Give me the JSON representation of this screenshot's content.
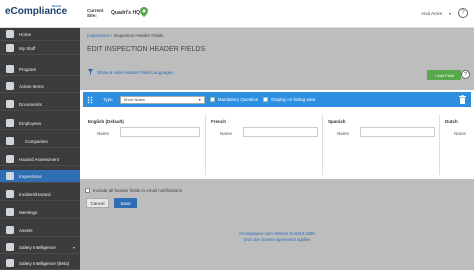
{
  "header": {
    "logo_text": "eCompliance",
    "logo_badge": "Mobile",
    "current_site_label": "Current\nSite:",
    "site_name": "Quadri's HQ",
    "user_name": "Anul Arora",
    "user_caret": "▾",
    "help": "?"
  },
  "sidebar": {
    "items": [
      {
        "label": "Home",
        "icon": "home-icon",
        "active": false
      },
      {
        "label": "My Stuff",
        "icon": "folder-icon",
        "active": false
      },
      {
        "label": "Program",
        "icon": "program-icon",
        "active": false
      },
      {
        "label": "Action Items",
        "icon": "checklist-icon",
        "active": false
      },
      {
        "label": "Documents",
        "icon": "document-icon",
        "active": false
      },
      {
        "label": "Employees",
        "icon": "employee-icon",
        "active": false
      },
      {
        "label": "Companies",
        "icon": "company-icon",
        "active": false
      },
      {
        "label": "Hazard Assessment",
        "icon": "hazard-icon",
        "active": false
      },
      {
        "label": "Inspections",
        "icon": "inspection-icon",
        "active": true
      },
      {
        "label": "Incident/Hazard",
        "icon": "incident-icon",
        "active": false
      },
      {
        "label": "Meetings",
        "icon": "meeting-icon",
        "active": false
      },
      {
        "label": "Assets",
        "icon": "asset-icon",
        "active": false
      },
      {
        "label": "Safety Intelligence",
        "icon": "chart-icon",
        "active": false
      },
      {
        "label": "Safety Intelligence (Beta)",
        "icon": "chart-icon",
        "active": false
      }
    ]
  },
  "breadcrumb": {
    "parent": "Inspections",
    "separator": "/",
    "current": "Inspection Header Fields"
  },
  "page_title": "EDIT INSPECTION HEADER FIELDS",
  "toolbar": {
    "language_link": "Show & Hide Header Field Languages",
    "add_field": "+ Add Field",
    "help": "?"
  },
  "field": {
    "type_label": "Type",
    "type_value": "Short Notes",
    "type_caret": "▾",
    "mandatory_label": "Mandatory Question",
    "display_label": "Display on listing view"
  },
  "languages": [
    {
      "name": "English (Default)",
      "field_label": "Name"
    },
    {
      "name": "French",
      "field_label": "Name"
    },
    {
      "name": "Spanish",
      "field_label": "Name"
    },
    {
      "name": "Dutch",
      "field_label": "Name"
    }
  ],
  "include_label": "Include all header fields in email notifications",
  "buttons": {
    "cancel": "Cancel",
    "save": "Save"
  },
  "footer": {
    "version": "eCompliance.com Version 12.6314.2295",
    "license": "End user license agreement applies"
  },
  "colors": {
    "sidebar_bg": "#3c3c3c",
    "active_item": "#2f6eb3",
    "field_header": "#2d8fe0",
    "add_button": "#5aa84d",
    "overlay": "#bdbdbd"
  }
}
